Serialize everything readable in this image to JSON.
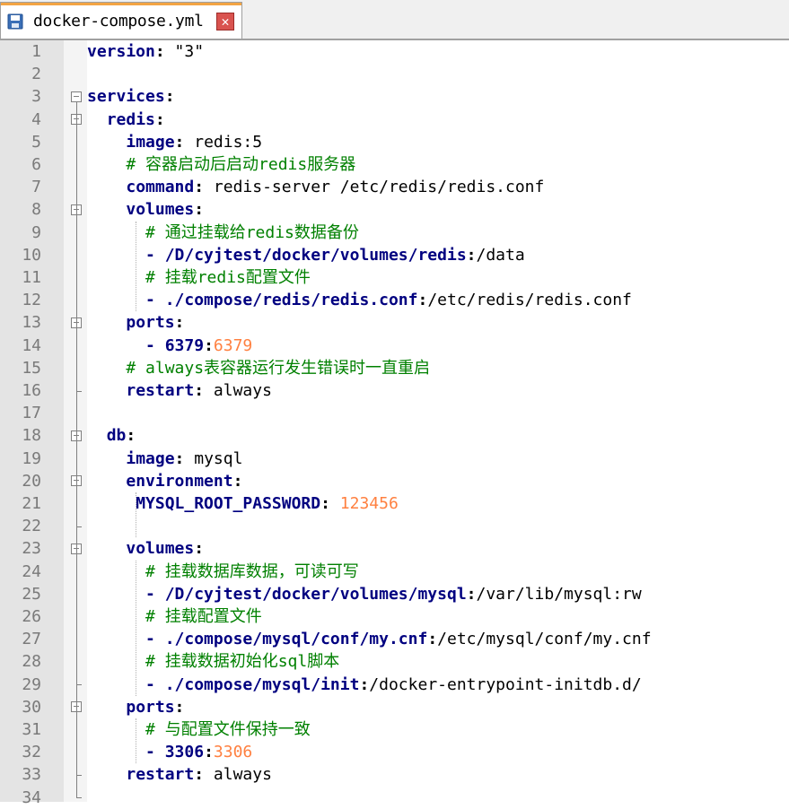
{
  "tab": {
    "filename": "docker-compose.yml",
    "close_icon": "close-icon",
    "save_icon": "floppy-icon"
  },
  "lines": [
    {
      "n": "1",
      "segs": [
        [
          "k",
          "version"
        ],
        [
          "p",
          ": "
        ],
        [
          "s",
          "\"3\""
        ]
      ]
    },
    {
      "n": "2",
      "segs": []
    },
    {
      "n": "3",
      "segs": [
        [
          "k",
          "services"
        ],
        [
          "p",
          ":"
        ]
      ]
    },
    {
      "n": "4",
      "segs": [
        [
          "s",
          "  "
        ],
        [
          "k",
          "redis"
        ],
        [
          "p",
          ":"
        ]
      ]
    },
    {
      "n": "5",
      "segs": [
        [
          "s",
          "    "
        ],
        [
          "k",
          "image"
        ],
        [
          "p",
          ":"
        ],
        [
          "s",
          " redis:5"
        ]
      ]
    },
    {
      "n": "6",
      "segs": [
        [
          "s",
          "    "
        ],
        [
          "c",
          "# 容器启动后启动redis服务器"
        ]
      ]
    },
    {
      "n": "7",
      "segs": [
        [
          "s",
          "    "
        ],
        [
          "k",
          "command"
        ],
        [
          "p",
          ":"
        ],
        [
          "s",
          " redis-server /etc/redis/redis.conf"
        ]
      ]
    },
    {
      "n": "8",
      "segs": [
        [
          "s",
          "    "
        ],
        [
          "k",
          "volumes"
        ],
        [
          "p",
          ":"
        ]
      ]
    },
    {
      "n": "9",
      "segs": [
        [
          "s",
          "      "
        ],
        [
          "c",
          "# 通过挂载给redis数据备份"
        ]
      ]
    },
    {
      "n": "10",
      "segs": [
        [
          "s",
          "      "
        ],
        [
          "d",
          "- /D/cyjtest/docker/volumes/redis"
        ],
        [
          "p",
          ":"
        ],
        [
          "s",
          "/data"
        ]
      ]
    },
    {
      "n": "11",
      "segs": [
        [
          "s",
          "      "
        ],
        [
          "c",
          "# 挂载redis配置文件"
        ]
      ]
    },
    {
      "n": "12",
      "segs": [
        [
          "s",
          "      "
        ],
        [
          "d",
          "- ./compose/redis/redis.conf"
        ],
        [
          "p",
          ":"
        ],
        [
          "s",
          "/etc/redis/redis.conf"
        ]
      ]
    },
    {
      "n": "13",
      "segs": [
        [
          "s",
          "    "
        ],
        [
          "k",
          "ports"
        ],
        [
          "p",
          ":"
        ]
      ]
    },
    {
      "n": "14",
      "segs": [
        [
          "s",
          "      "
        ],
        [
          "d",
          "- 6379"
        ],
        [
          "p",
          ":"
        ],
        [
          "n",
          "6379"
        ]
      ]
    },
    {
      "n": "15",
      "segs": [
        [
          "s",
          "    "
        ],
        [
          "c",
          "# always表容器运行发生错误时一直重启"
        ]
      ]
    },
    {
      "n": "16",
      "segs": [
        [
          "s",
          "    "
        ],
        [
          "k",
          "restart"
        ],
        [
          "p",
          ":"
        ],
        [
          "s",
          " always"
        ]
      ]
    },
    {
      "n": "17",
      "segs": []
    },
    {
      "n": "18",
      "segs": [
        [
          "s",
          "  "
        ],
        [
          "k",
          "db"
        ],
        [
          "p",
          ":"
        ]
      ]
    },
    {
      "n": "19",
      "segs": [
        [
          "s",
          "    "
        ],
        [
          "k",
          "image"
        ],
        [
          "p",
          ":"
        ],
        [
          "s",
          " mysql"
        ]
      ]
    },
    {
      "n": "20",
      "segs": [
        [
          "s",
          "    "
        ],
        [
          "k",
          "environment"
        ],
        [
          "p",
          ":"
        ]
      ]
    },
    {
      "n": "21",
      "segs": [
        [
          "s",
          "     "
        ],
        [
          "k",
          "MYSQL_ROOT_PASSWORD"
        ],
        [
          "p",
          ":"
        ],
        [
          "s",
          " "
        ],
        [
          "n",
          "123456"
        ]
      ]
    },
    {
      "n": "22",
      "segs": []
    },
    {
      "n": "23",
      "segs": [
        [
          "s",
          "    "
        ],
        [
          "k",
          "volumes"
        ],
        [
          "p",
          ":"
        ]
      ]
    },
    {
      "n": "24",
      "segs": [
        [
          "s",
          "      "
        ],
        [
          "c",
          "# 挂载数据库数据，可读可写"
        ]
      ]
    },
    {
      "n": "25",
      "segs": [
        [
          "s",
          "      "
        ],
        [
          "d",
          "- /D/cyjtest/docker/volumes/mysql"
        ],
        [
          "p",
          ":"
        ],
        [
          "s",
          "/var/lib/mysql:rw"
        ]
      ]
    },
    {
      "n": "26",
      "segs": [
        [
          "s",
          "      "
        ],
        [
          "c",
          "# 挂载配置文件"
        ]
      ]
    },
    {
      "n": "27",
      "segs": [
        [
          "s",
          "      "
        ],
        [
          "d",
          "- ./compose/mysql/conf/my.cnf"
        ],
        [
          "p",
          ":"
        ],
        [
          "s",
          "/etc/mysql/conf/my.cnf"
        ]
      ]
    },
    {
      "n": "28",
      "segs": [
        [
          "s",
          "      "
        ],
        [
          "c",
          "# 挂载数据初始化sql脚本"
        ]
      ]
    },
    {
      "n": "29",
      "segs": [
        [
          "s",
          "      "
        ],
        [
          "d",
          "- ./compose/mysql/init"
        ],
        [
          "p",
          ":"
        ],
        [
          "s",
          "/docker-entrypoint-initdb.d/"
        ]
      ]
    },
    {
      "n": "30",
      "segs": [
        [
          "s",
          "    "
        ],
        [
          "k",
          "ports"
        ],
        [
          "p",
          ":"
        ]
      ]
    },
    {
      "n": "31",
      "segs": [
        [
          "s",
          "      "
        ],
        [
          "c",
          "# 与配置文件保持一致"
        ]
      ]
    },
    {
      "n": "32",
      "segs": [
        [
          "s",
          "      "
        ],
        [
          "d",
          "- 3306"
        ],
        [
          "p",
          ":"
        ],
        [
          "n",
          "3306"
        ]
      ]
    },
    {
      "n": "33",
      "segs": [
        [
          "s",
          "    "
        ],
        [
          "k",
          "restart"
        ],
        [
          "p",
          ":"
        ],
        [
          "s",
          " always"
        ]
      ]
    },
    {
      "n": "34",
      "segs": []
    }
  ],
  "folds": [
    "3",
    "4",
    "8",
    "13",
    "18",
    "20",
    "23",
    "30"
  ]
}
